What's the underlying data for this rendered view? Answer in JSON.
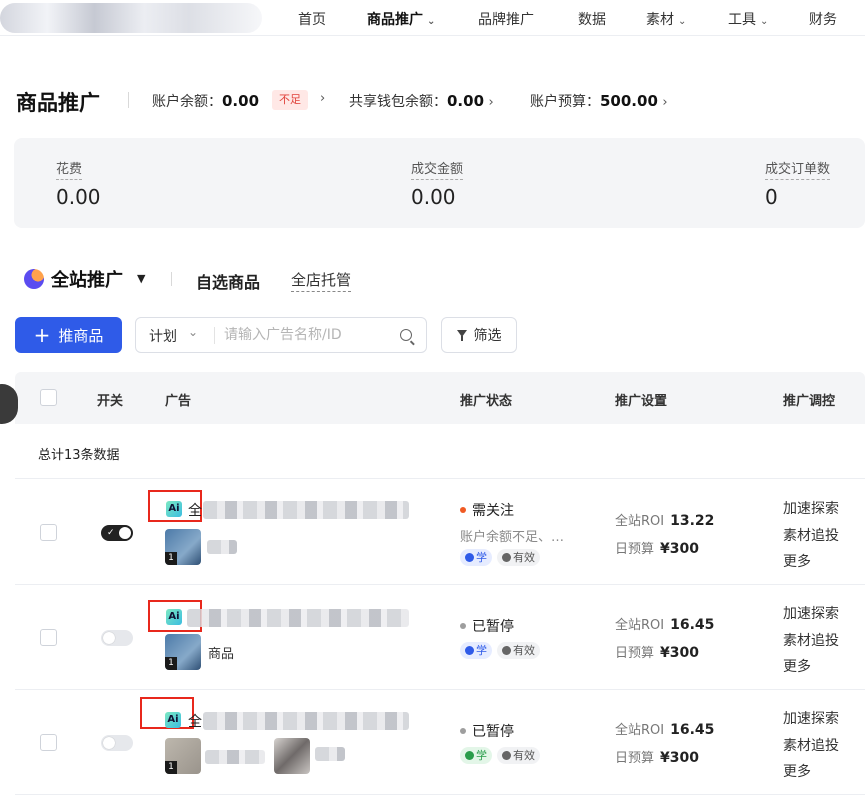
{
  "nav": {
    "items": [
      "首页",
      "商品推广",
      "品牌推广",
      "数据",
      "素材",
      "工具",
      "财务"
    ]
  },
  "header": {
    "title": "商品推广",
    "balance_label": "账户余额：",
    "balance_value": "0.00",
    "balance_badge": "不足",
    "wallet_label": "共享钱包余额：",
    "wallet_value": "0.00",
    "budget_label": "账户预算：",
    "budget_value": "500.00"
  },
  "stats": [
    {
      "label": "花费",
      "value": "0.00"
    },
    {
      "label": "成交金额",
      "value": "0.00"
    },
    {
      "label": "成交订单数",
      "value": "0"
    }
  ],
  "tabs": {
    "main": "全站推广",
    "second": "自选商品",
    "third": "全店托管"
  },
  "toolbar": {
    "add_label": "推商品",
    "plan_label": "计划",
    "search_placeholder": "请输入广告名称/ID",
    "filter_label": "筛选"
  },
  "table": {
    "headers": [
      "开关",
      "广告",
      "推广状态",
      "推广设置",
      "推广调控"
    ],
    "total": "总计13条数据",
    "rows": [
      {
        "name": "全",
        "thumb_label": "",
        "status": "需关注",
        "status_sub": "账户余额不足、…",
        "tag_learn": "学",
        "tag_valid": "有效",
        "roi_label": "全站ROI",
        "roi_value": "13.22",
        "budget_label": "日预算",
        "budget_value": "¥300",
        "actions": [
          "加速探索",
          "素材追投",
          "更多"
        ]
      },
      {
        "name": "",
        "thumb_label": "商品",
        "status": "已暂停",
        "status_sub": "",
        "tag_learn": "学",
        "tag_valid": "有效",
        "roi_label": "全站ROI",
        "roi_value": "16.45",
        "budget_label": "日预算",
        "budget_value": "¥300",
        "actions": [
          "加速探索",
          "素材追投",
          "更多"
        ]
      },
      {
        "name": "全",
        "thumb_label": "",
        "status": "已暂停",
        "status_sub": "",
        "tag_learn": "学",
        "tag_valid": "有效",
        "roi_label": "全站ROI",
        "roi_value": "16.45",
        "budget_label": "日预算",
        "budget_value": "¥300",
        "actions": [
          "加速探索",
          "素材追投",
          "更多"
        ]
      }
    ]
  },
  "colors": {
    "primary": "#2f5be8",
    "danger": "#e0413a",
    "highlight_box": "#e8281c"
  }
}
